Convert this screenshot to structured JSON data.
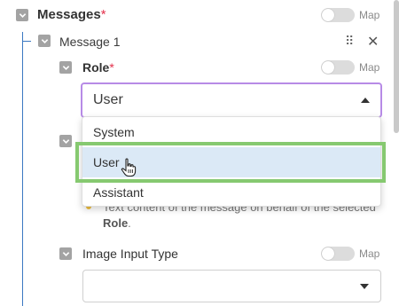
{
  "messages": {
    "label": "Messages",
    "required_mark": "*",
    "map_label": "Map"
  },
  "message1": {
    "label": "Message 1"
  },
  "role": {
    "label": "Role",
    "required_mark": "*",
    "map_label": "Map",
    "selected_value": "User",
    "options": [
      "System",
      "User",
      "Assistant"
    ],
    "hint_prefix": "Text content of the message on behalf of the selected",
    "hint_bold": "Role",
    "hint_suffix": "."
  },
  "image_input_type": {
    "label": "Image Input Type",
    "map_label": "Map",
    "selected_value": ""
  },
  "colors": {
    "accent_focus": "#b78be6",
    "highlight": "#dbe9f6",
    "annotation_box": "#86c970",
    "required": "#e3304b",
    "tree_line": "#3a78c2"
  }
}
